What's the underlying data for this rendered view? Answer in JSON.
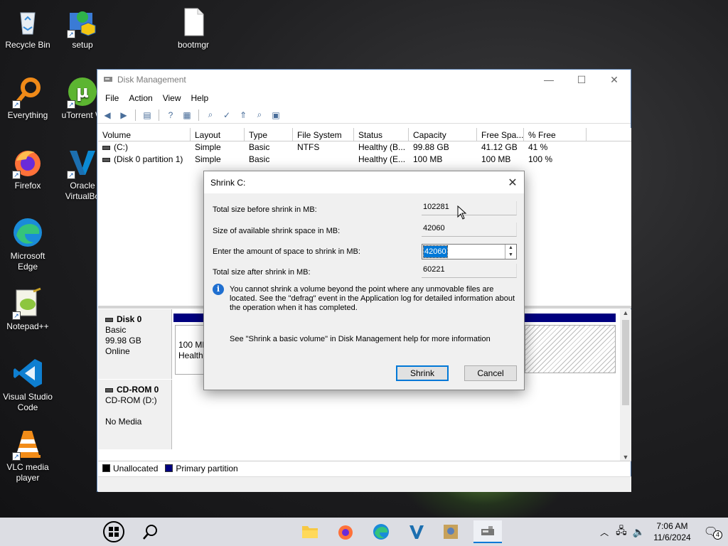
{
  "desktop": {
    "icons": [
      {
        "label": "Recycle Bin"
      },
      {
        "label": "setup"
      },
      {
        "label": "bootmgr"
      },
      {
        "label": "Everything"
      },
      {
        "label": "uTorrent W"
      },
      {
        "label": "Firefox"
      },
      {
        "label": "Oracle VirtualBo"
      },
      {
        "label": "Microsoft Edge"
      },
      {
        "label": "Notepad++"
      },
      {
        "label": "Visual Studio Code"
      },
      {
        "label": "VLC media player"
      }
    ]
  },
  "window": {
    "title": "Disk Management",
    "menu": [
      "File",
      "Action",
      "View",
      "Help"
    ],
    "columns": [
      "Volume",
      "Layout",
      "Type",
      "File System",
      "Status",
      "Capacity",
      "Free Spa...",
      "% Free"
    ],
    "volumes": [
      {
        "volume": "(C:)",
        "layout": "Simple",
        "type": "Basic",
        "fs": "NTFS",
        "status": "Healthy (B...",
        "capacity": "99.88 GB",
        "free": "41.12 GB",
        "pct": "41 %"
      },
      {
        "volume": "(Disk 0 partition 1)",
        "layout": "Simple",
        "type": "Basic",
        "fs": "",
        "status": "Healthy (E...",
        "capacity": "100 MB",
        "free": "100 MB",
        "pct": "100 %"
      }
    ],
    "disks": {
      "disk0": {
        "name": "Disk 0",
        "type": "Basic",
        "size": "99.98 GB",
        "state": "Online",
        "partition_size": "100 MB",
        "partition_status": "Healthy"
      },
      "cdrom0": {
        "name": "CD-ROM 0",
        "drive": "CD-ROM (D:)",
        "media": "No Media"
      }
    },
    "legend": {
      "unallocated": "Unallocated",
      "primary": "Primary partition"
    }
  },
  "dialog": {
    "title": "Shrink C:",
    "total_before_label": "Total size before shrink in MB:",
    "total_before_value": "102281",
    "available_label": "Size of available shrink space in MB:",
    "available_value": "42060",
    "amount_label": "Enter the amount of space to shrink in MB:",
    "amount_value": "42060",
    "total_after_label": "Total size after shrink in MB:",
    "total_after_value": "60221",
    "info_text": "You cannot shrink a volume beyond the point where any unmovable files are located. See the \"defrag\" event in the Application log for detailed information about the operation when it has completed.",
    "help_text": "See \"Shrink a basic volume\" in Disk Management help for more information",
    "shrink_button": "Shrink",
    "cancel_button": "Cancel"
  },
  "taskbar": {
    "time": "7:06 AM",
    "date": "11/6/2024",
    "notification_count": "4"
  },
  "colors": {
    "primary_partition": "#00007f",
    "accent": "#0078d7",
    "unallocated": "#000000"
  }
}
